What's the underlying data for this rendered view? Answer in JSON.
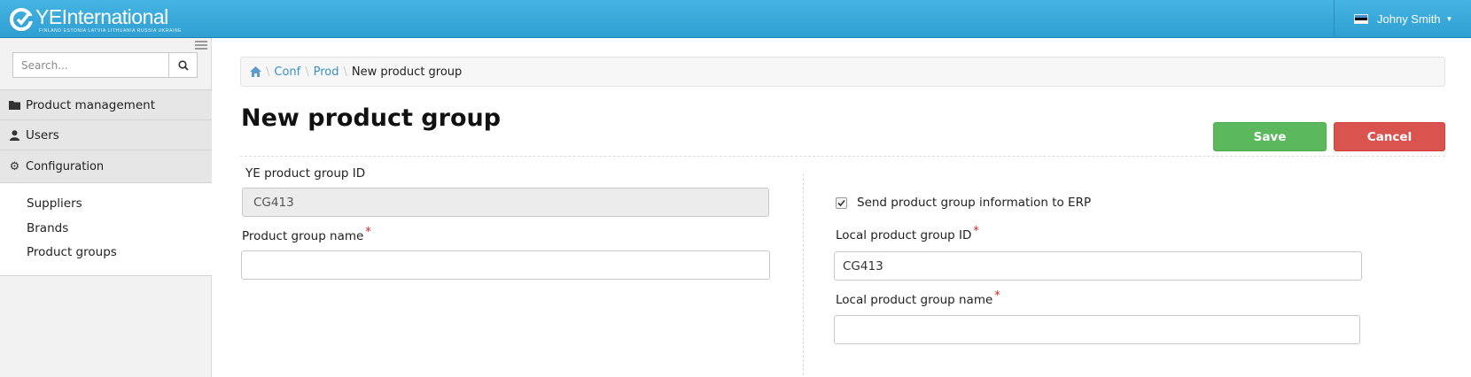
{
  "app": {
    "logo_text": "YEInternational",
    "logo_subtitle": "FINLAND  ESTONIA  LATVIA  LITHUANIA  RUSSIA  UKRAINE",
    "user_name": "Johny Smith"
  },
  "sidebar": {
    "search_placeholder": "Search...",
    "items": [
      {
        "label": "Product management",
        "icon": "folder-icon"
      },
      {
        "label": "Users",
        "icon": "user-icon"
      },
      {
        "label": "Configuration",
        "icon": "gear-icon"
      }
    ],
    "subitems": [
      "Suppliers",
      "Brands",
      "Product groups"
    ]
  },
  "breadcrumb": {
    "items": [
      "Conf",
      "Prod"
    ],
    "current": "New product group"
  },
  "page": {
    "title": "New product group",
    "save_label": "Save",
    "cancel_label": "Cancel"
  },
  "form": {
    "ye_id_label": "YE product group ID",
    "ye_id_value": "CG413",
    "name_label": "Product group name",
    "name_value": "",
    "erp_label": "Send product group information to ERP",
    "erp_checked": true,
    "local_id_label": "Local product group ID",
    "local_id_value": "CG413",
    "local_name_label": "Local product group name",
    "local_name_value": "",
    "required_mark": "*"
  },
  "colors": {
    "header": "#36a8dc",
    "save": "#5cb85c",
    "cancel": "#d9534f",
    "link": "#3a8fc8",
    "required": "#e02020"
  }
}
